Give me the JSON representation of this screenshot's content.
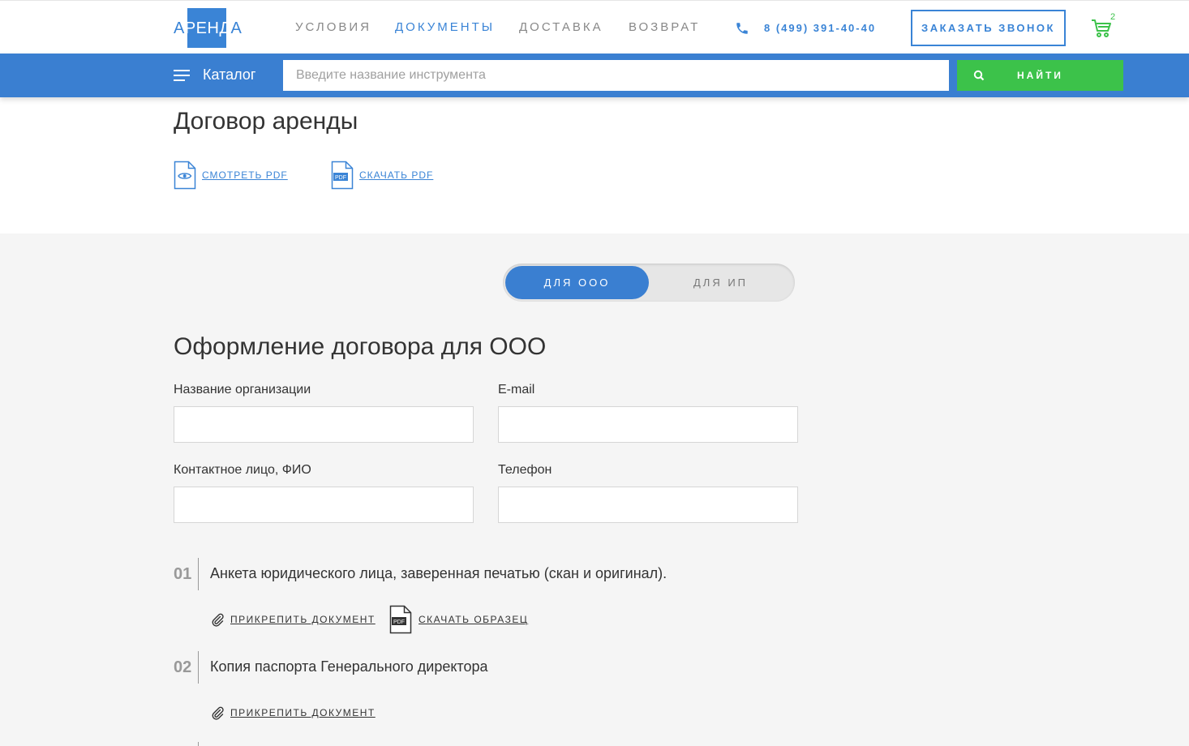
{
  "header": {
    "logo_text_left": "А",
    "logo_text_mid": "РЕНД",
    "logo_text_right": "А",
    "nav": [
      "УСЛОВИЯ",
      "ДОКУМЕНТЫ",
      "ДОСТАВКА",
      "ВОЗВРАТ"
    ],
    "active_nav": "ДОКУМЕНТЫ",
    "phone": "8 (499) 391-40-40",
    "call_button": "ЗАКАЗАТЬ ЗВОНОК",
    "cart_count": "2"
  },
  "searchbar": {
    "catalog_label": "Каталог",
    "placeholder": "Введите название инструмента",
    "find_button": "НАЙТИ"
  },
  "document": {
    "title": "Договор аренды",
    "view_link": "СМОТРЕТЬ PDF",
    "download_link": "СКАЧАТЬ PDF"
  },
  "toggle": {
    "option_ooo": "ДЛЯ ООО",
    "option_ip": "ДЛЯ ИП",
    "selected": "ДЛЯ ООО"
  },
  "form": {
    "title": "Оформление договора для ООО",
    "org_name_label": "Название организации",
    "email_label": "E-mail",
    "contact_label": "Контактное лицо, ФИО",
    "phone_label": "Телефон"
  },
  "steps": [
    {
      "num": "01",
      "text": "Анкета юридического лица, заверенная печатью (скан и оригинал).",
      "attach": "ПРИКРЕПИТЬ ДОКУМЕНТ",
      "sample": "СКАЧАТЬ ОБРАЗЕЦ"
    },
    {
      "num": "02",
      "text": "Копия паспорта Генерального директора",
      "attach": "ПРИКРЕПИТЬ ДОКУМЕНТ"
    }
  ],
  "colors": {
    "brand_blue": "#3a84d6",
    "bar_blue": "#3a7fd1",
    "green": "#3cc24a",
    "gray_bg": "#f5f5f5"
  }
}
